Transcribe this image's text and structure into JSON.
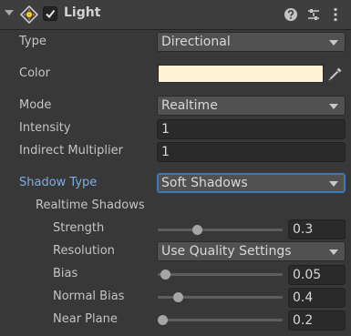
{
  "header": {
    "title": "Light",
    "enabled": true
  },
  "rows": {
    "type": {
      "label": "Type",
      "value": "Directional"
    },
    "color": {
      "label": "Color",
      "value": "#fff4d6"
    },
    "mode": {
      "label": "Mode",
      "value": "Realtime"
    },
    "intensity": {
      "label": "Intensity",
      "value": "1"
    },
    "indirect": {
      "label": "Indirect Multiplier",
      "value": "1"
    },
    "shadow_type": {
      "label": "Shadow Type",
      "value": "Soft Shadows"
    },
    "realtime_shadows": {
      "label": "Realtime Shadows"
    },
    "strength": {
      "label": "Strength",
      "value": "0.3",
      "fraction": 0.3
    },
    "resolution": {
      "label": "Resolution",
      "value": "Use Quality Settings"
    },
    "bias": {
      "label": "Bias",
      "value": "0.05",
      "fraction": 0.025
    },
    "normal_bias": {
      "label": "Normal Bias",
      "value": "0.4",
      "fraction": 0.133
    },
    "near_plane": {
      "label": "Near Plane",
      "value": "0.2",
      "fraction": 0.0
    }
  },
  "icons": [
    "foldout-arrow-icon",
    "light-component-icon",
    "checkmark-icon",
    "help-icon",
    "presets-icon",
    "more-options-icon",
    "eyedropper-icon"
  ],
  "colors": {
    "background": "#383838",
    "accent_label": "#7bafe2",
    "focus_border": "#3a79bb"
  }
}
